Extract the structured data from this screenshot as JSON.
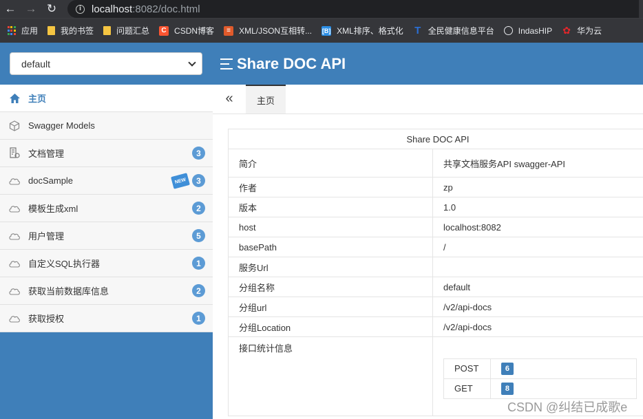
{
  "browser": {
    "url_host": "localhost",
    "url_rest": ":8082/doc.html",
    "bookmarks": [
      {
        "label": "应用",
        "icon": "apps-grid-icon",
        "color": "#e8eaed"
      },
      {
        "label": "我的书签",
        "icon": "folder-icon",
        "color": "#f5c542"
      },
      {
        "label": "问题汇总",
        "icon": "folder-icon",
        "color": "#f5c542"
      },
      {
        "label": "CSDN博客",
        "icon": "csdn-icon",
        "color": "#fc5531"
      },
      {
        "label": "XML/JSON互相转...",
        "icon": "converter-icon",
        "color": "#e05a2b"
      },
      {
        "label": "XML排序、格式化",
        "icon": "bracket-icon",
        "color": "#2a8ee6"
      },
      {
        "label": "全民健康信息平台",
        "icon": "health-icon",
        "color": "#2a6fd6"
      },
      {
        "label": "IndasHIP",
        "icon": "globe-icon",
        "color": "#e8eaed"
      },
      {
        "label": "华为云",
        "icon": "huawei-icon",
        "color": "#e3262a"
      }
    ]
  },
  "header": {
    "group_select_value": "default",
    "title": "Share DOC API"
  },
  "sidebar": {
    "items": [
      {
        "label": "主页",
        "icon": "home-icon",
        "badge": "",
        "active": true
      },
      {
        "label": "Swagger Models",
        "icon": "cube-icon",
        "badge": ""
      },
      {
        "label": "文档管理",
        "icon": "doc-settings-icon",
        "badge": "3"
      },
      {
        "label": "docSample",
        "icon": "cloud-api-icon",
        "badge": "3",
        "new_tag": "NEW"
      },
      {
        "label": "模板生成xml",
        "icon": "cloud-api-icon",
        "badge": "2"
      },
      {
        "label": "用户管理",
        "icon": "cloud-api-icon",
        "badge": "5"
      },
      {
        "label": "自定义SQL执行器",
        "icon": "cloud-api-icon",
        "badge": "1"
      },
      {
        "label": "获取当前数据库信息",
        "icon": "cloud-api-icon",
        "badge": "2"
      },
      {
        "label": "获取授权",
        "icon": "cloud-api-icon",
        "badge": "1"
      }
    ]
  },
  "main": {
    "tab_label": "主页",
    "table_title": "Share DOC API",
    "rows": [
      {
        "key": "简介",
        "value": "共享文档服务API  swagger-API"
      },
      {
        "key": "作者",
        "value": "zp"
      },
      {
        "key": "版本",
        "value": "1.0"
      },
      {
        "key": "host",
        "value": "localhost:8082"
      },
      {
        "key": "basePath",
        "value": "/"
      },
      {
        "key": "服务Url",
        "value": ""
      },
      {
        "key": "分组名称",
        "value": "default"
      },
      {
        "key": "分组url",
        "value": "/v2/api-docs"
      },
      {
        "key": "分组Location",
        "value": "/v2/api-docs"
      }
    ],
    "stats_label": "接口统计信息",
    "stats": [
      {
        "method": "POST",
        "count": "6"
      },
      {
        "method": "GET",
        "count": "8"
      }
    ]
  },
  "watermark": "CSDN @纠结已成歌e"
}
